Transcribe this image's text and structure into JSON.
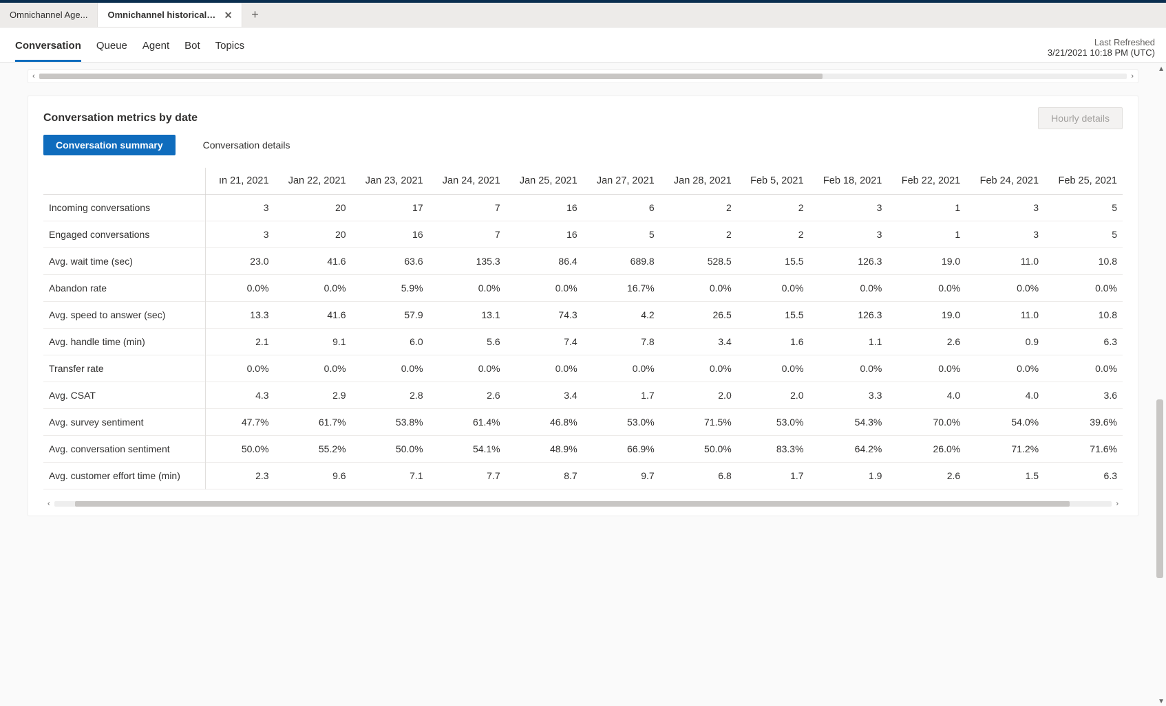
{
  "tabs": {
    "inactive": "Omnichannel Age...",
    "active": "Omnichannel historical an..."
  },
  "nav": {
    "items": [
      "Conversation",
      "Queue",
      "Agent",
      "Bot",
      "Topics"
    ],
    "activeIndex": 0
  },
  "refresh": {
    "label": "Last Refreshed",
    "value": "3/21/2021 10:18 PM (UTC)"
  },
  "card": {
    "title": "Conversation metrics by date",
    "hourly_label": "Hourly details",
    "sub_tabs": {
      "summary": "Conversation summary",
      "details": "Conversation details"
    }
  },
  "chart_data": {
    "type": "table",
    "columns": [
      "ın 21, 2021",
      "Jan 22, 2021",
      "Jan 23, 2021",
      "Jan 24, 2021",
      "Jan 25, 2021",
      "Jan 27, 2021",
      "Jan 28, 2021",
      "Feb 5, 2021",
      "Feb 18, 2021",
      "Feb 22, 2021",
      "Feb 24, 2021",
      "Feb 25, 2021"
    ],
    "metrics": [
      {
        "name": "Incoming conversations",
        "values": [
          "3",
          "20",
          "17",
          "7",
          "16",
          "6",
          "2",
          "2",
          "3",
          "1",
          "3",
          "5"
        ]
      },
      {
        "name": "Engaged conversations",
        "values": [
          "3",
          "20",
          "16",
          "7",
          "16",
          "5",
          "2",
          "2",
          "3",
          "1",
          "3",
          "5"
        ]
      },
      {
        "name": "Avg. wait time (sec)",
        "values": [
          "23.0",
          "41.6",
          "63.6",
          "135.3",
          "86.4",
          "689.8",
          "528.5",
          "15.5",
          "126.3",
          "19.0",
          "11.0",
          "10.8"
        ]
      },
      {
        "name": "Abandon rate",
        "values": [
          "0.0%",
          "0.0%",
          "5.9%",
          "0.0%",
          "0.0%",
          "16.7%",
          "0.0%",
          "0.0%",
          "0.0%",
          "0.0%",
          "0.0%",
          "0.0%"
        ]
      },
      {
        "name": "Avg. speed to answer (sec)",
        "values": [
          "13.3",
          "41.6",
          "57.9",
          "13.1",
          "74.3",
          "4.2",
          "26.5",
          "15.5",
          "126.3",
          "19.0",
          "11.0",
          "10.8"
        ]
      },
      {
        "name": "Avg. handle time (min)",
        "values": [
          "2.1",
          "9.1",
          "6.0",
          "5.6",
          "7.4",
          "7.8",
          "3.4",
          "1.6",
          "1.1",
          "2.6",
          "0.9",
          "6.3"
        ]
      },
      {
        "name": "Transfer rate",
        "values": [
          "0.0%",
          "0.0%",
          "0.0%",
          "0.0%",
          "0.0%",
          "0.0%",
          "0.0%",
          "0.0%",
          "0.0%",
          "0.0%",
          "0.0%",
          "0.0%"
        ]
      },
      {
        "name": "Avg. CSAT",
        "values": [
          "4.3",
          "2.9",
          "2.8",
          "2.6",
          "3.4",
          "1.7",
          "2.0",
          "2.0",
          "3.3",
          "4.0",
          "4.0",
          "3.6"
        ]
      },
      {
        "name": "Avg. survey sentiment",
        "values": [
          "47.7%",
          "61.7%",
          "53.8%",
          "61.4%",
          "46.8%",
          "53.0%",
          "71.5%",
          "53.0%",
          "54.3%",
          "70.0%",
          "54.0%",
          "39.6%"
        ]
      },
      {
        "name": "Avg. conversation sentiment",
        "values": [
          "50.0%",
          "55.2%",
          "50.0%",
          "54.1%",
          "48.9%",
          "66.9%",
          "50.0%",
          "83.3%",
          "64.2%",
          "26.0%",
          "71.2%",
          "71.6%"
        ]
      },
      {
        "name": "Avg. customer effort time (min)",
        "values": [
          "2.3",
          "9.6",
          "7.1",
          "7.7",
          "8.7",
          "9.7",
          "6.8",
          "1.7",
          "1.9",
          "2.6",
          "1.5",
          "6.3"
        ]
      }
    ]
  }
}
